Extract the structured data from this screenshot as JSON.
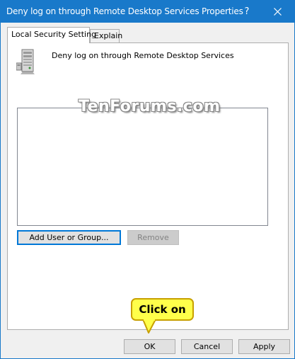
{
  "window": {
    "title": "Deny log on through Remote Desktop Services Properties",
    "help_label": "?",
    "close_icon": "close-icon"
  },
  "tabs": [
    {
      "label": "Local Security Setting",
      "active": true
    },
    {
      "label": "Explain",
      "active": false
    }
  ],
  "policy": {
    "icon": "server-icon",
    "name": "Deny log on through Remote Desktop Services"
  },
  "members_list": {
    "items": []
  },
  "buttons": {
    "add_label": "Add User or Group...",
    "remove_label": "Remove",
    "ok_label": "OK",
    "cancel_label": "Cancel",
    "apply_label": "Apply"
  },
  "watermark": "TenForums.com",
  "callout": {
    "text": "Click on"
  },
  "colors": {
    "titlebar": "#1979ca",
    "focus_border": "#0078d7",
    "callout_fill": "#ffff4a"
  }
}
